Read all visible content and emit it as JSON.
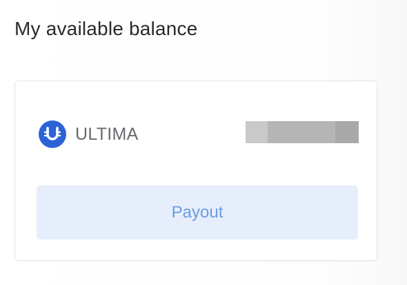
{
  "header": {
    "title": "My available balance"
  },
  "balance_card": {
    "token": {
      "name": "ULTIMA",
      "logo_icon": "ultima-logo-icon",
      "logo_color": "#2c63d6"
    },
    "balance_value_hidden": true
  },
  "actions": {
    "payout_label": "Payout",
    "payout_bg": "#e7eefb",
    "payout_text_color": "#6b9be3"
  }
}
